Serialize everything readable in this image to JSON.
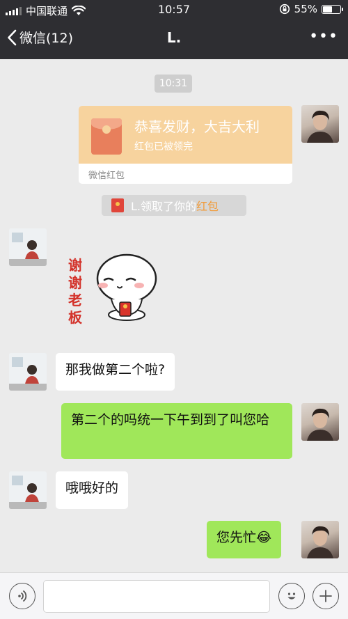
{
  "status_bar": {
    "carrier": "中国联通",
    "time": "10:57",
    "battery_percent": "55%",
    "battery_level": 0.55,
    "signal_bars": 4,
    "icons": [
      "signal-icon",
      "wifi-icon",
      "rotation-lock-icon",
      "battery-icon"
    ]
  },
  "nav": {
    "back_label": "微信(12)",
    "title": "L.",
    "more_label": "•••"
  },
  "chat": {
    "timestamp": "10:31",
    "red_packet": {
      "title": "恭喜发财，大吉大利",
      "status": "红包已被领完",
      "footer": "微信红包"
    },
    "system_notice": {
      "prefix": "L.领取了你的",
      "highlight": "红包"
    },
    "sticker": {
      "text_lines": [
        "谢",
        "谢",
        "老",
        "板"
      ]
    },
    "messages": [
      {
        "sender": "them",
        "text": "那我做第二个啦?"
      },
      {
        "sender": "me",
        "text": "第二个的吗统一下午到到了叫您哈"
      },
      {
        "sender": "them",
        "text": "哦哦好的"
      },
      {
        "sender": "me",
        "text": "您先忙😂"
      }
    ]
  },
  "input_bar": {
    "voice_icon": "voice-icon",
    "emoji_icon": "emoji-icon",
    "plus_icon": "plus-icon",
    "input_value": ""
  },
  "colors": {
    "nav_bg": "#2e2e32",
    "chat_bg": "#ebebeb",
    "green_bubble": "#a0e75a",
    "red_packet": "#f7d39e",
    "highlight_orange": "#f29b38"
  }
}
